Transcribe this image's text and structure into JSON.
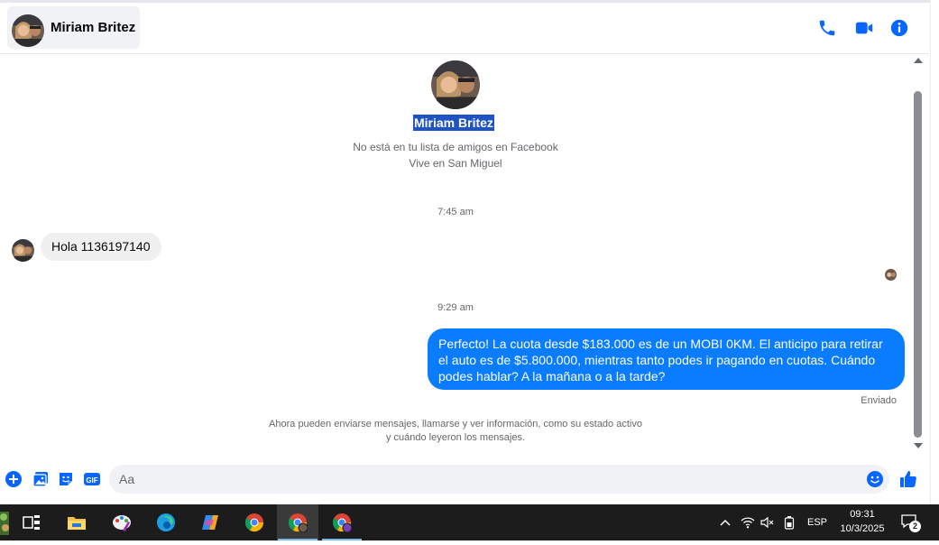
{
  "header": {
    "contact_name": "Miriam Britez",
    "icons": [
      "phone-icon",
      "video-call-icon",
      "info-icon"
    ]
  },
  "profile": {
    "name": "Miriam Britez",
    "friend_status": "No está en tu lista de amigos en Facebook",
    "location": "Vive en San Miguel"
  },
  "messages": {
    "time_1": "7:45 am",
    "incoming_1": "Hola 1136197140",
    "time_2": "9:29 am",
    "outgoing_1": "Perfecto! La cuota desde $183.000 es de un MOBI 0KM. El anticipo para retirar el auto es de $5.800.000, mientras tanto podes ir pagando en cuotas. Cuándo podes hablar? A la mañana o a la tarde?",
    "sent_status": "Enviado",
    "info_note_line1": "Ahora pueden enviarse mensajes, llamarse y ver información, como su estado activo",
    "info_note_line2": "y cuándo leyeron los mensajes."
  },
  "composer": {
    "placeholder": "Aa",
    "value": ""
  },
  "taskbar": {
    "apps": [
      "task-view",
      "file-explorer",
      "paint",
      "edge",
      "copilot",
      "chrome",
      "chrome-profile",
      "chrome-profile-2"
    ],
    "tray": {
      "language": "ESP",
      "time": "09:31",
      "date": "10/3/2025",
      "notification_count": "2"
    }
  },
  "colors": {
    "accent": "#0a7cff",
    "messenger_blue": "#0866ff",
    "selection": "#1f53c4",
    "taskbar": "#1c1c1c"
  }
}
